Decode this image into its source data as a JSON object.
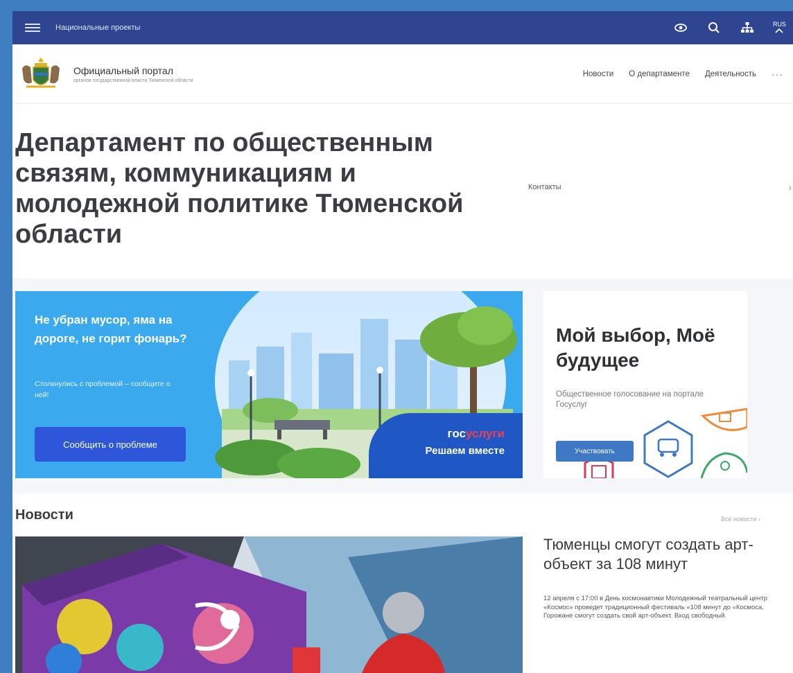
{
  "topbar": {
    "national_projects": "Национальные проекты",
    "lang": "RUS",
    "colors": {
      "bg": "#2f4592"
    },
    "icons": [
      "menu-icon",
      "eye-icon",
      "search-icon",
      "sitemap-icon",
      "language-icon"
    ]
  },
  "header": {
    "portal_title": "Официальный портал",
    "portal_subtitle": "органов государственной власти Тюменской области",
    "nav": [
      {
        "label": "Новости"
      },
      {
        "label": "О департаменте"
      },
      {
        "label": "Деятельность"
      }
    ],
    "more": "···"
  },
  "hero": {
    "title": "Департамент по общественным связям, коммуникациям и молодежной политике Тюменской области",
    "contacts": "Контакты"
  },
  "banner": {
    "message": "Не убран мусор, яма на дороге, не горит фонарь?",
    "sub": "Столкнулись с проблемой – сообщите о ней!",
    "button": "Сообщить о проблеме",
    "gos_prefix": "гос",
    "gos_suffix": "услуги",
    "gos_slogan": "Решаем вместе",
    "colors": {
      "bg": "#3aa9ee",
      "button": "#2d56d8",
      "accent_red": "#ee3f58"
    }
  },
  "choice": {
    "headline": "Мой выбор, Моё будущее",
    "text": "Общественное голосование на портале Госуслуг",
    "button": "Участвовать"
  },
  "news": {
    "heading": "Новости",
    "all_news": "Все новости",
    "item_title": "Тюменцы смогут создать арт-объект за 108 минут",
    "item_text": "12 апреля с 17:00 в День космонавтики Молодежный театральный центр «Космос» проведет традиционный фестиваль «108 минут до «Космоса. Горожане смогут создать свой арт-объект. Вход свободный."
  }
}
